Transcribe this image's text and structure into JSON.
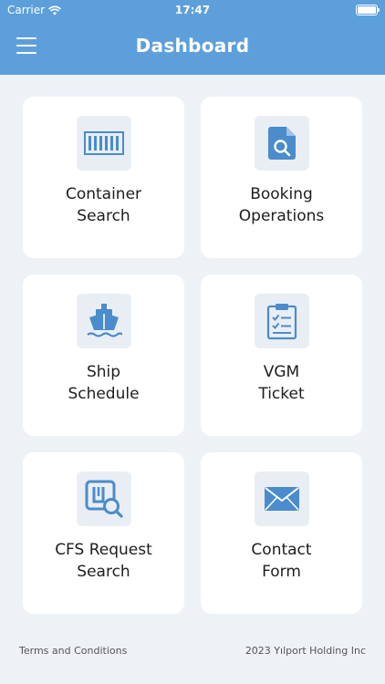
{
  "status_bar": {
    "carrier": "Carrier",
    "time": "17:47"
  },
  "header": {
    "title": "Dashboard"
  },
  "cards": [
    {
      "label": "Container\nSearch",
      "icon": "container-icon"
    },
    {
      "label": "Booking\nOperations",
      "icon": "document-search-icon"
    },
    {
      "label": "Ship\nSchedule",
      "icon": "ship-icon"
    },
    {
      "label": "VGM\nTicket",
      "icon": "clipboard-checklist-icon"
    },
    {
      "label": "CFS Request\nSearch",
      "icon": "cfs-search-icon"
    },
    {
      "label": "Contact\nForm",
      "icon": "envelope-icon"
    }
  ],
  "footer": {
    "terms": "Terms and Conditions",
    "copyright": "2023 Yılport Holding Inc"
  },
  "colors": {
    "accent": "#5d9fdb",
    "icon": "#4a8ccc",
    "background": "#eef2f7",
    "card": "#ffffff",
    "icon_tile": "#e9eef4"
  }
}
